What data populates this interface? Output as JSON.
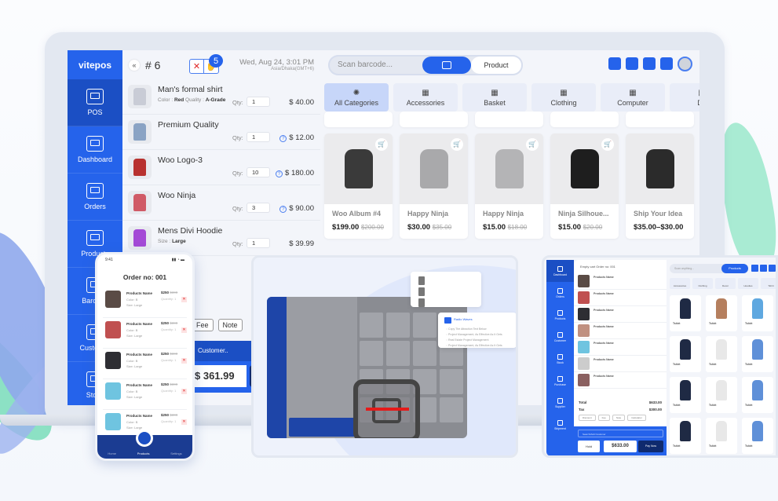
{
  "main_app": {
    "brand": "vitepos",
    "sidebar": {
      "items": [
        {
          "label": "POS",
          "icon": "pos-terminal-icon",
          "active": true
        },
        {
          "label": "Dashboard",
          "icon": "dashboard-monitor-icon",
          "active": false
        },
        {
          "label": "Orders",
          "icon": "orders-clipboard-icon",
          "active": false
        },
        {
          "label": "Products",
          "icon": "products-cart-icon",
          "active": false
        },
        {
          "label": "Barcode",
          "icon": "barcode-scan-icon",
          "active": false
        },
        {
          "label": "Customer",
          "icon": "customer-icon",
          "active": false
        },
        {
          "label": "Stock",
          "icon": "stock-icon",
          "active": false
        }
      ]
    },
    "cart": {
      "order_label": "# 6",
      "back_symbol": "«",
      "clear_symbol": "✕",
      "hold_symbol": "✋",
      "hold_count": "5",
      "date": "Wed, Aug 24, 3:01 PM",
      "timezone": "Asia/Dhaka(GMT+6)",
      "qty_label": "Qty:",
      "items": [
        {
          "name": "Man's formal shirt",
          "meta": [
            {
              "k": "Color :",
              "v": "Red"
            },
            {
              "k": "Quality :",
              "v": "A-Grade"
            }
          ],
          "qty": "1",
          "price": "$ 40.00",
          "info": false,
          "color": "#c9ccd6"
        },
        {
          "name": "Premium Quality",
          "meta": [],
          "qty": "1",
          "price": "$ 12.00",
          "info": true,
          "color": "#8aa3c4"
        },
        {
          "name": "Woo Logo-3",
          "meta": [],
          "qty": "10",
          "price": "$ 180.00",
          "info": true,
          "color": "#b8312f"
        },
        {
          "name": "Woo Ninja",
          "meta": [],
          "qty": "3",
          "price": "$ 90.00",
          "info": true,
          "color": "#d05a66"
        },
        {
          "name": "Mens Divi Hoodie",
          "meta": [
            {
              "k": "Size :",
              "v": "Large"
            }
          ],
          "qty": "1",
          "price": "$ 39.99",
          "info": false,
          "color": "#a44ad6"
        }
      ],
      "actions": [
        "Fee",
        "Note"
      ],
      "customer_placeholder": "Customer..",
      "total": "$ 361.99"
    },
    "products": {
      "search_placeholder": "Scan barcode...",
      "product_tab": "Product",
      "toolbar_icons": [
        "refresh-icon",
        "wifi-icon",
        "store-icon",
        "collapse-icon"
      ],
      "categories": [
        {
          "label": "All Categories",
          "icon": "✺",
          "active": true
        },
        {
          "label": "Accessories",
          "icon": "▦",
          "active": false
        },
        {
          "label": "Basket",
          "icon": "▦",
          "active": false
        },
        {
          "label": "Clothing",
          "icon": "▦",
          "active": false
        },
        {
          "label": "Computer",
          "icon": "▦",
          "active": false
        },
        {
          "label": "De",
          "icon": "▦",
          "active": false
        }
      ],
      "cards": [
        {
          "name": "Woo Album #4",
          "price": "$199.00",
          "old_price": "$200.00",
          "color": "#3a3a3a",
          "cart": true
        },
        {
          "name": "Happy Ninja",
          "price": "$30.00",
          "old_price": "$35.00",
          "color": "#a9a9ab",
          "cart": true
        },
        {
          "name": "Happy Ninja",
          "price": "$15.00",
          "old_price": "$18.00",
          "color": "#b4b4b6",
          "cart": true
        },
        {
          "name": "Ninja Silhoue...",
          "price": "$15.00",
          "old_price": "$20.00",
          "color": "#1e1e1e",
          "cart": true
        },
        {
          "name": "Ship Your Idea",
          "price": "$35.00–$30.00",
          "old_price": "",
          "color": "#2b2b2b",
          "cart": false
        }
      ]
    }
  },
  "phone": {
    "time": "9:41",
    "title": "Order no: 001",
    "item_name": "Products Name",
    "color_label": "Color:",
    "color_value": "B",
    "size_label": "Size:",
    "size_value": "Large",
    "price": "$250",
    "old_price": "$300",
    "qty_label": "Quantity:",
    "qty": "1",
    "thumb_colors": [
      "#5a4b45",
      "#c05050",
      "#2e2e33",
      "#6fc4e0",
      "#6fc4e0"
    ],
    "nav": [
      "Home",
      "Products",
      "Settings"
    ]
  },
  "tablet_right": {
    "header": "Empty cart  Order no: 001",
    "search_placeholder": "Scan anything...",
    "products_btn": "Products",
    "categories": [
      "Accessories",
      "Clothing",
      "Decor",
      "Hoodies",
      "Tshirt"
    ],
    "nav": [
      "Dashboard",
      "Orders",
      "Products",
      "Customer",
      "Stock",
      "Purchase",
      "Supplier",
      "Shipment"
    ],
    "item_name": "Products Name",
    "thumb_colors": [
      "#5a4b45",
      "#c05050",
      "#2e2e33",
      "#c09080",
      "#6fc4e0",
      "#ccc",
      "#8a6060"
    ],
    "total_label": "Total",
    "total_value": "$633.00",
    "tax_label": "Tax",
    "tax_value": "$300.00",
    "actions": [
      "Discount",
      "Fee",
      "Note",
      "Calculator"
    ],
    "customer_placeholder": "Search/Add Customer",
    "add": "Add",
    "hold": "Hold",
    "amount": "$633.00",
    "pay_now": "Pay Now",
    "card_label": "Tshirt",
    "card_colors": [
      "#1f2a44",
      "#b57f5e",
      "#5fa8e0",
      "#1f2a44",
      "#e8e8e8",
      "#5f90d8",
      "#1f2a44",
      "#e8e8e8",
      "#5f90d8",
      "#1f2a44",
      "#e8e8e8",
      "#5f90d8"
    ]
  },
  "tablet_center": {
    "popup_title": "Radio Waves",
    "popup_lines": [
      "Copy The Attraction Text Below",
      "Project Management, As Effective As It Gets",
      "Real Estate Project Management",
      "Project Management, As Effective As It Gets"
    ]
  }
}
